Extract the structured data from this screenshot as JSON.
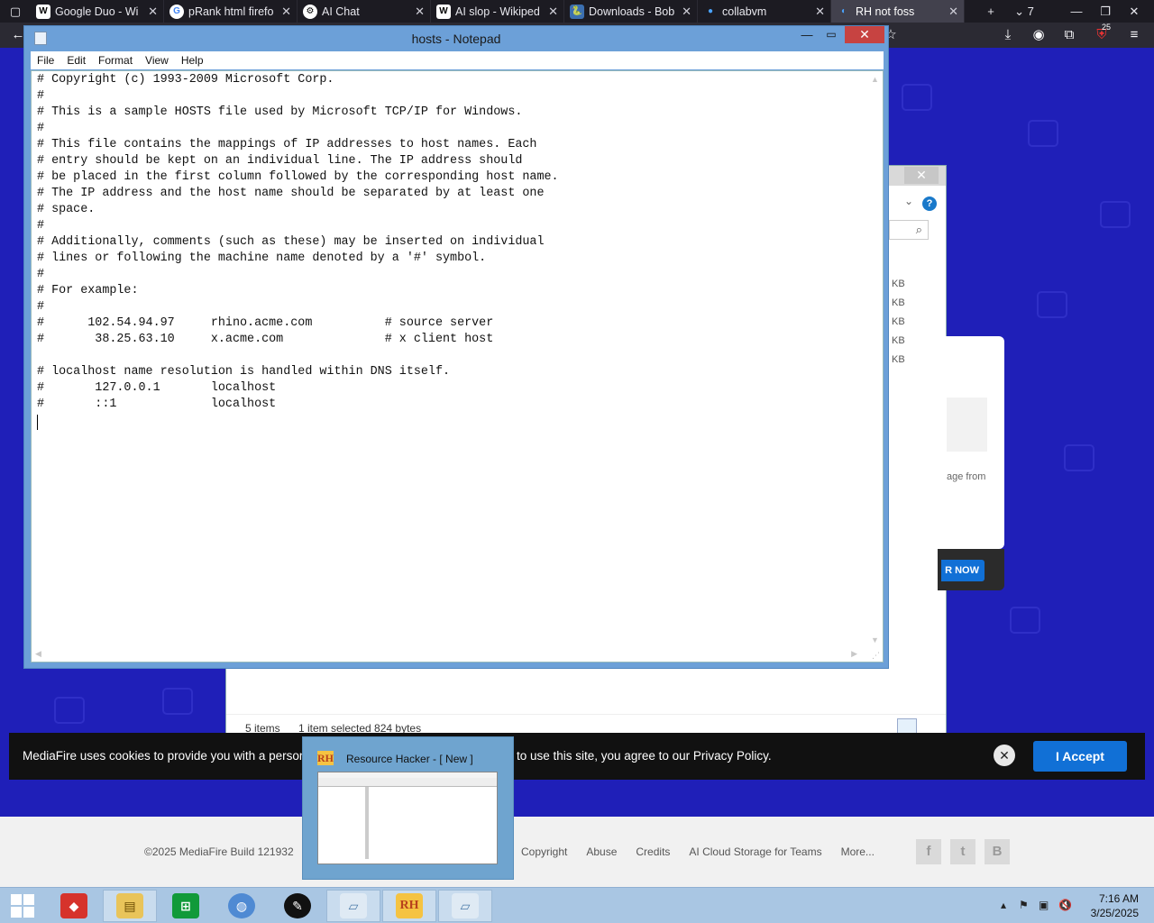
{
  "browser": {
    "tabs": [
      {
        "title": "Google Duo - Wi",
        "favicon": "W",
        "active": false
      },
      {
        "title": "pRank html firefo",
        "favicon": "G",
        "active": false
      },
      {
        "title": "AI Chat",
        "favicon": "⚙",
        "active": false
      },
      {
        "title": "AI slop - Wikiped",
        "favicon": "W",
        "active": false
      },
      {
        "title": "Downloads - Bob",
        "favicon": "🐍",
        "active": false
      },
      {
        "title": "collabvm",
        "favicon": "●",
        "active": false
      },
      {
        "title": "RH not foss",
        "favicon": "◐",
        "active": true
      }
    ],
    "new_tab_label": "+",
    "tab_list_count": "7",
    "extension_badge": "25"
  },
  "notepad": {
    "title": "hosts - Notepad",
    "menu": [
      "File",
      "Edit",
      "Format",
      "View",
      "Help"
    ],
    "content": "# Copyright (c) 1993-2009 Microsoft Corp.\n#\n# This is a sample HOSTS file used by Microsoft TCP/IP for Windows.\n#\n# This file contains the mappings of IP addresses to host names. Each\n# entry should be kept on an individual line. The IP address should\n# be placed in the first column followed by the corresponding host name.\n# The IP address and the host name should be separated by at least one\n# space.\n#\n# Additionally, comments (such as these) may be inserted on individual\n# lines or following the machine name denoted by a '#' symbol.\n#\n# For example:\n#\n#      102.54.94.97     rhino.acme.com          # source server\n#       38.25.63.10     x.acme.com              # x client host\n\n# localhost name resolution is handled within DNS itself.\n#       127.0.0.1       localhost\n#       ::1             localhost"
  },
  "explorer": {
    "sizes": [
      "KB",
      "KB",
      "KB",
      "KB",
      "KB"
    ],
    "status_items": "5 items",
    "status_selected": "1 item selected  824 bytes"
  },
  "mediafire": {
    "card_text": "age from",
    "now_button": "R NOW",
    "cookie_text_left": "MediaFire uses cookies to provide you with a persona",
    "cookie_text_right": "to use this site, you agree to our Privacy Policy.",
    "cookie_accept": "I Accept",
    "footer_copyright": "©2025 MediaFire Build 121932",
    "footer_links": [
      "Copyright",
      "Abuse",
      "Credits",
      "AI Cloud Storage for Teams",
      "More..."
    ],
    "social": [
      "f",
      "t",
      "B"
    ]
  },
  "taskbar_preview": {
    "title": "Resource Hacker - [ New ]",
    "icon_text": "RH"
  },
  "taskbar": {
    "apps": [
      "start",
      "rh-red-icon",
      "file-explorer",
      "store",
      "browser-globe",
      "ink-app",
      "notepad",
      "resource-hacker",
      "notepad-2"
    ],
    "rh_label": "RH",
    "clock_time": "7:16 AM",
    "clock_date": "3/25/2025"
  },
  "colors": {
    "desktop_blue": "#1f1fb8",
    "notepad_frame": "#6ca0d8",
    "close_red": "#c74341",
    "accent_blue": "#1170d6"
  }
}
